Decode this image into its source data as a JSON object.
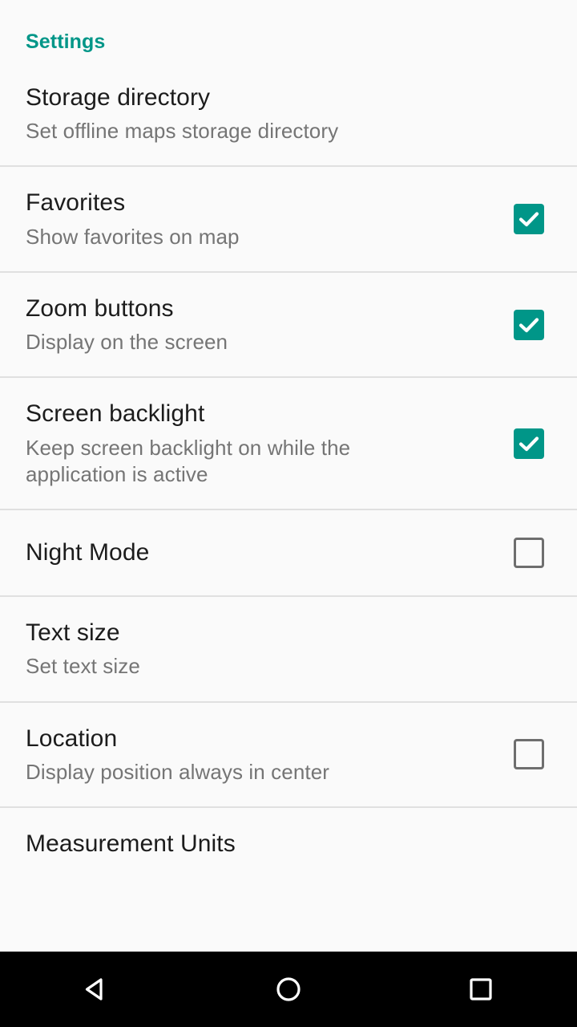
{
  "colors": {
    "accent": "#009688",
    "background": "#fafafa",
    "title_text": "#1c1c1c",
    "subtitle_text": "#757575",
    "divider": "#e0e0e0",
    "checkbox_unchecked_border": "#6e6e6e",
    "navbar_background": "#000000",
    "navbar_icon": "#ffffff"
  },
  "category": {
    "header": "Settings"
  },
  "settings": {
    "items": [
      {
        "title": "Storage directory",
        "subtitle": "Set offline maps storage directory",
        "control": "none",
        "checked": null
      },
      {
        "title": "Favorites",
        "subtitle": "Show favorites on map",
        "control": "checkbox",
        "checked": true
      },
      {
        "title": "Zoom buttons",
        "subtitle": "Display on the screen",
        "control": "checkbox",
        "checked": true
      },
      {
        "title": "Screen backlight",
        "subtitle": "Keep screen backlight on while the application is active",
        "control": "checkbox",
        "checked": true
      },
      {
        "title": "Night Mode",
        "subtitle": "",
        "control": "checkbox",
        "checked": false
      },
      {
        "title": "Text size",
        "subtitle": "Set text size",
        "control": "none",
        "checked": null
      },
      {
        "title": "Location",
        "subtitle": "Display position always in center",
        "control": "checkbox",
        "checked": false
      },
      {
        "title": "Measurement Units",
        "subtitle": "",
        "control": "none",
        "checked": null
      }
    ]
  },
  "navbar": {
    "back": "back-triangle-icon",
    "home": "home-circle-icon",
    "recents": "recents-square-icon"
  }
}
